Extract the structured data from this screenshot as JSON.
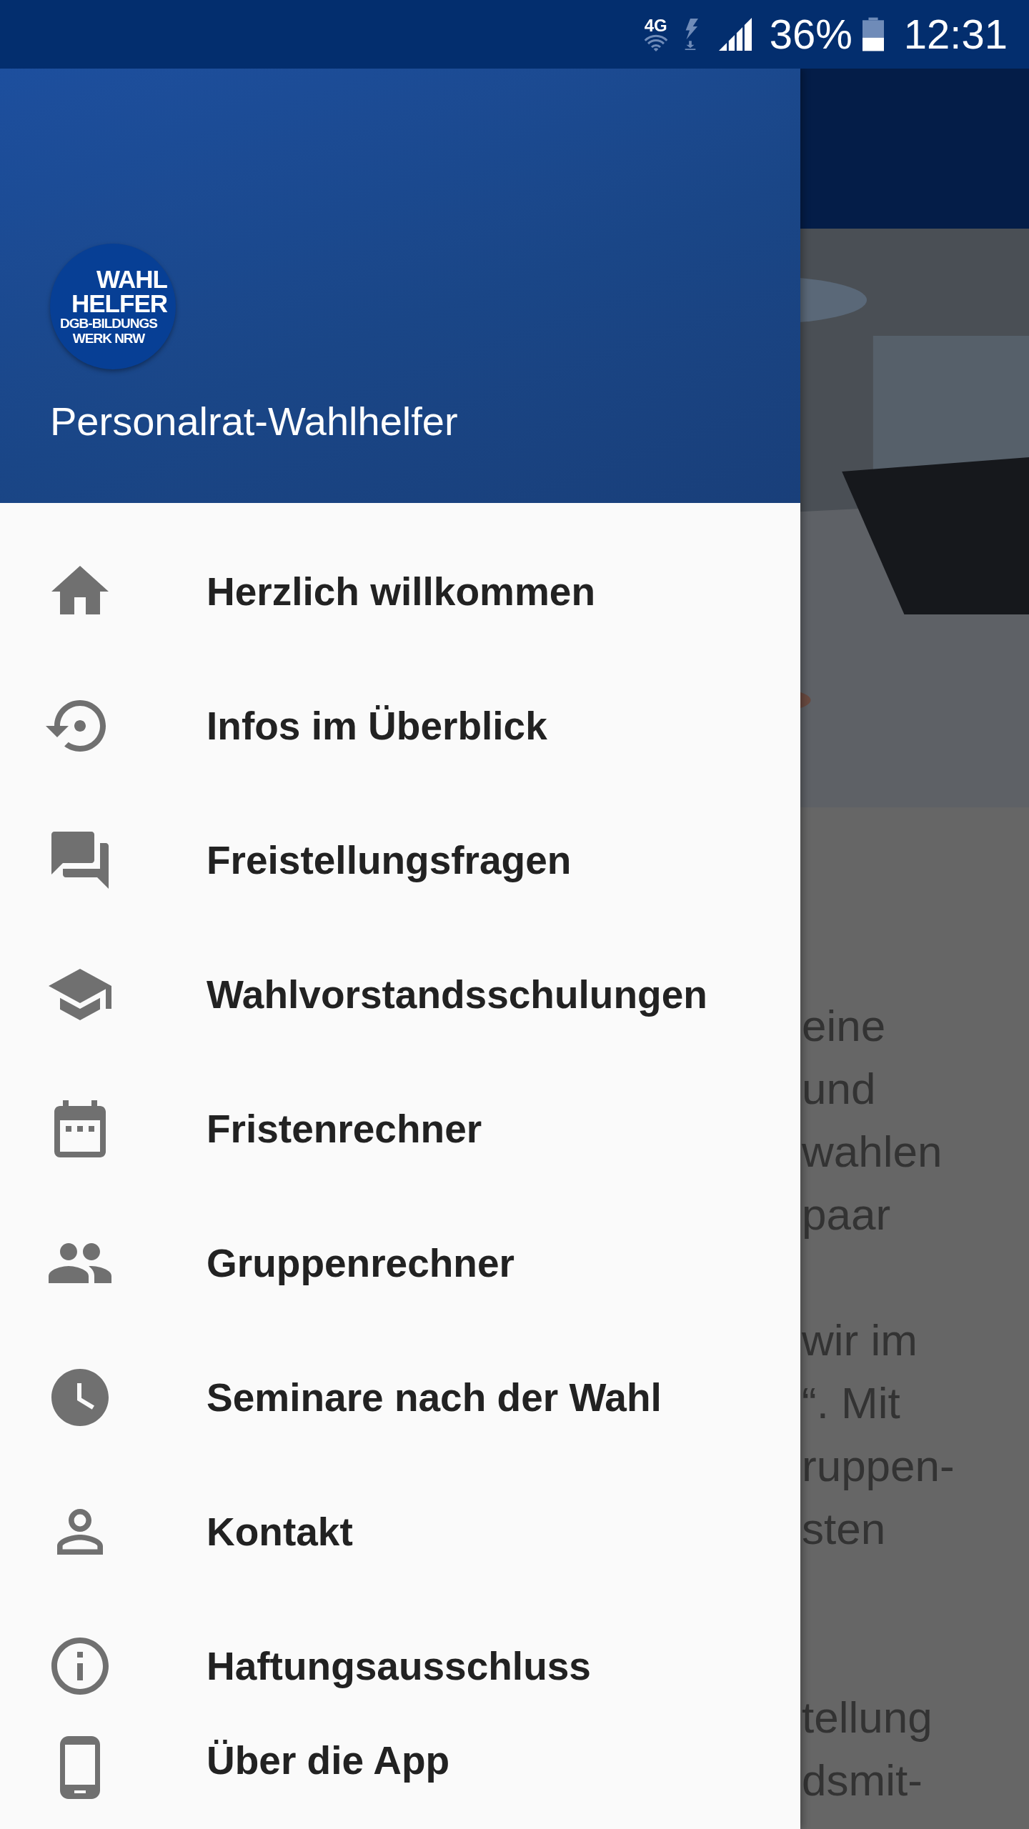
{
  "status_bar": {
    "network": "4G",
    "battery": "36%",
    "time": "12:31"
  },
  "drawer": {
    "logo": {
      "lines": [
        "WAHL",
        "HELFER",
        "DGB-BILDUNGS",
        "WERK NRW"
      ]
    },
    "title": "Personalrat-Wahlhelfer",
    "items": [
      {
        "label": "Herzlich willkommen"
      },
      {
        "label": "Infos im Überblick"
      },
      {
        "label": "Freistellungsfragen"
      },
      {
        "label": "Wahlvorstandsschulungen"
      },
      {
        "label": "Fristenrechner"
      },
      {
        "label": "Gruppenrechner"
      },
      {
        "label": "Seminare nach der Wahl"
      },
      {
        "label": "Kontakt"
      },
      {
        "label": "Haftungsausschluss"
      },
      {
        "label": "Über die App"
      }
    ]
  },
  "content": {
    "header_image": {
      "kind": "picture"
    },
    "paragraphs": [
      [
        "eine",
        "und",
        "wahlen",
        "paar"
      ],
      [
        "wir im",
        "“. Mit",
        "ruppen-",
        "sten"
      ],
      [
        "tellung",
        "dsmit-"
      ]
    ]
  }
}
